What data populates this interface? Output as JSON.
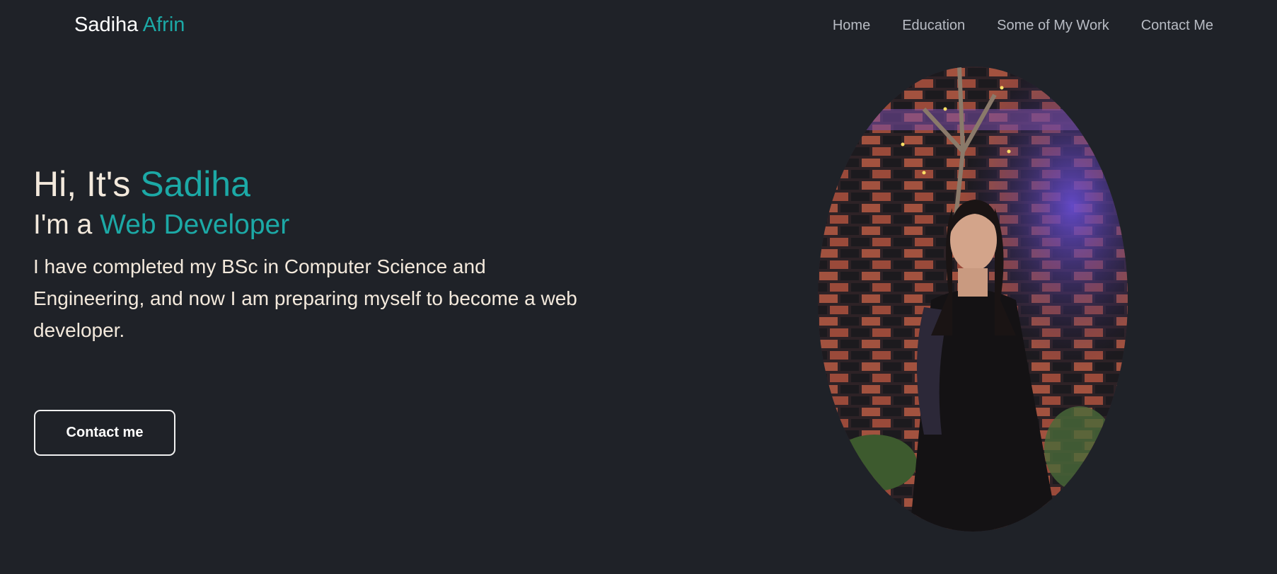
{
  "navbar": {
    "brand_first": "Sadiha",
    "brand_last": "Afrin",
    "links": [
      {
        "label": "Home"
      },
      {
        "label": "Education"
      },
      {
        "label": "Some of My Work"
      },
      {
        "label": "Contact Me"
      }
    ]
  },
  "hero": {
    "greeting_prefix": "Hi, It's ",
    "greeting_name": "Sadiha",
    "role_prefix": "I'm a ",
    "role_title": "Web Developer",
    "bio": "I have completed my BSc in Computer Science and Engineering, and now I am preparing myself to become a web developer.",
    "cta_label": "Contact me"
  },
  "colors": {
    "background": "#1f2228",
    "accent": "#1ca9a6",
    "text": "#f3e9dc",
    "nav_text": "#b8bcc4"
  }
}
